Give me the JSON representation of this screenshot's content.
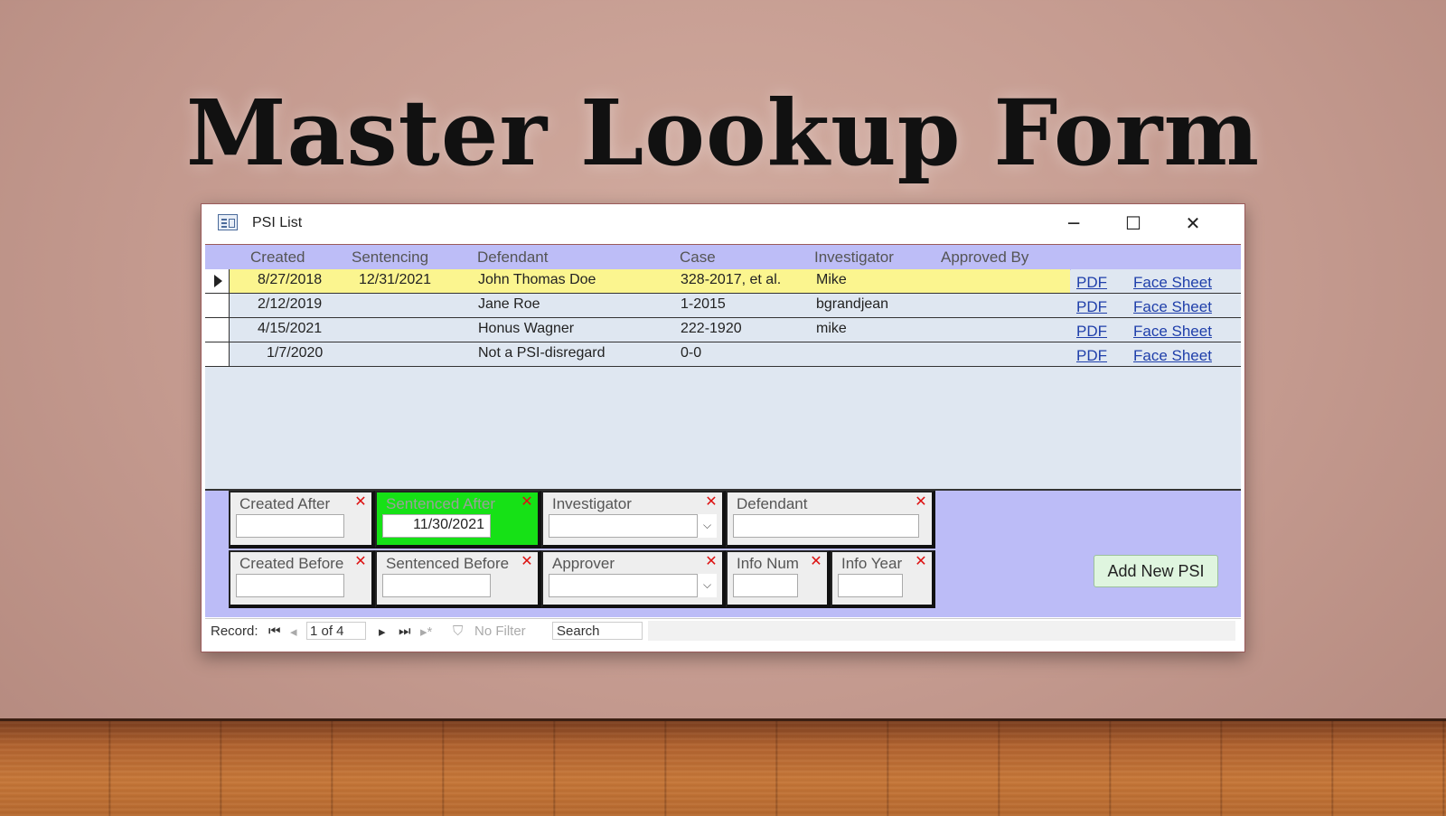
{
  "slide": {
    "title": "Master Lookup Form"
  },
  "window": {
    "title": "PSI List",
    "controls": {
      "minimize": "─",
      "maximize": "☐",
      "close": "✕"
    }
  },
  "grid": {
    "headers": [
      "Created",
      "Sentencing",
      "Defendant",
      "Case",
      "Investigator",
      "Approved By"
    ],
    "rows": [
      {
        "created": "8/27/2018",
        "sentencing": "12/31/2021",
        "defendant": "John Thomas Doe",
        "case": "328-2017, et al.",
        "investigator": "Mike",
        "approved_by": "",
        "pdf": "PDF",
        "face_sheet": "Face Sheet"
      },
      {
        "created": "2/12/2019",
        "sentencing": "",
        "defendant": "Jane Roe",
        "case": "1-2015",
        "investigator": "bgrandjean",
        "approved_by": "",
        "pdf": "PDF",
        "face_sheet": "Face Sheet"
      },
      {
        "created": "4/15/2021",
        "sentencing": "",
        "defendant": "Honus Wagner",
        "case": "222-1920",
        "investigator": "mike",
        "approved_by": "",
        "pdf": "PDF",
        "face_sheet": "Face Sheet"
      },
      {
        "created": "1/7/2020",
        "sentencing": "",
        "defendant": "Not a PSI-disregard",
        "case": "0-0",
        "investigator": "",
        "approved_by": "",
        "pdf": "PDF",
        "face_sheet": "Face Sheet"
      }
    ]
  },
  "filters": {
    "created_after": {
      "label": "Created After",
      "value": ""
    },
    "sentenced_after": {
      "label": "Sentenced After",
      "value": "11/30/2021"
    },
    "investigator": {
      "label": "Investigator",
      "value": ""
    },
    "defendant": {
      "label": "Defendant",
      "value": ""
    },
    "created_before": {
      "label": "Created Before",
      "value": ""
    },
    "sentenced_before": {
      "label": "Sentenced Before",
      "value": ""
    },
    "approver": {
      "label": "Approver",
      "value": ""
    },
    "info_num": {
      "label": "Info Num",
      "value": ""
    },
    "info_year": {
      "label": "Info Year",
      "value": ""
    },
    "clear_symbol": "✕",
    "dropdown_symbol": "⌵"
  },
  "add_button": {
    "label": "Add New PSI"
  },
  "navigator": {
    "record_label": "Record:",
    "position": "1 of 4",
    "filter_label": "No Filter",
    "search_label": "Search",
    "first": "⏮",
    "prev": "◂",
    "next": "▸",
    "last": "⏭",
    "new": "▸*"
  },
  "colors": {
    "header_bg": "#bdbdf7",
    "selected_row": "#fbf58f",
    "active_filter": "#16e116",
    "link": "#1f3faa"
  }
}
